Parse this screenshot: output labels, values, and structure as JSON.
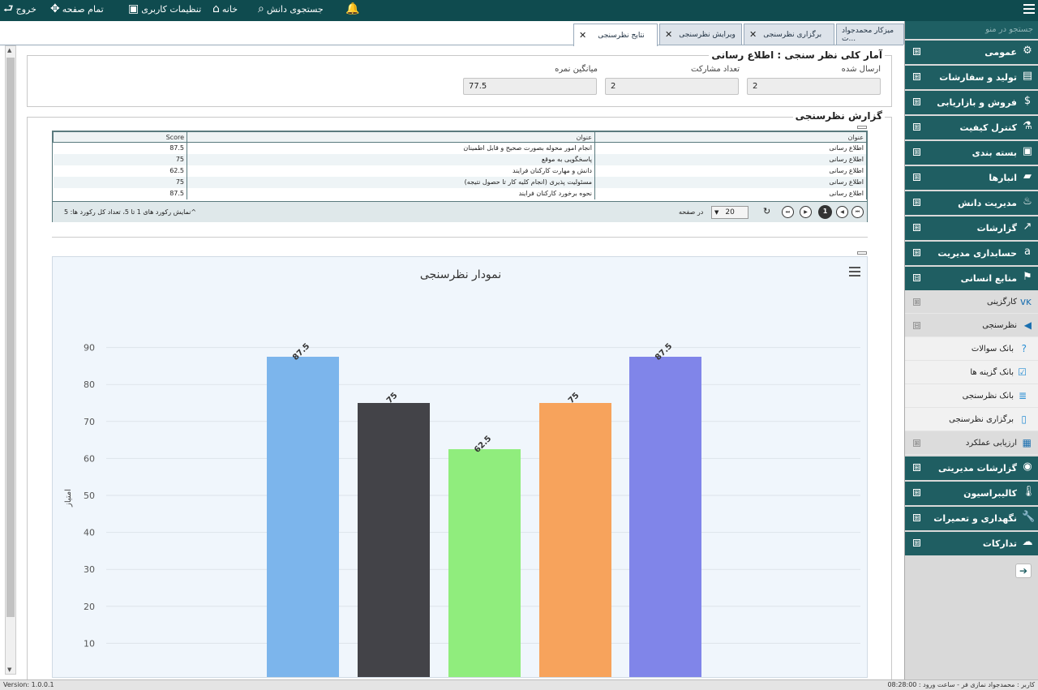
{
  "topbar": {
    "exit": "خروج",
    "fullscreen": "تمام صفحه",
    "user_settings": "تنظیمات کاربری",
    "home": "خانه",
    "knowledge_search": "جستجوی دانش"
  },
  "tabs": [
    {
      "label": "میزکار محمدجواد ت...",
      "closable": false
    },
    {
      "label": "برگزاری نظرسنجی",
      "closable": true
    },
    {
      "label": "ویرایش نظرسنجی",
      "closable": true
    },
    {
      "label": "نتایج نظرسنجی",
      "closable": true,
      "active": true
    }
  ],
  "stats": {
    "title": "آمار کلی نظر سنجی : اطلاع رسانی",
    "sent_label": "ارسال شده",
    "sent_value": "2",
    "participants_label": "تعداد مشارکت",
    "participants_value": "2",
    "avg_label": "میانگین نمره",
    "avg_value": "77.5"
  },
  "report": {
    "title": "گزارش نظرسنجی",
    "columns": [
      "عنوان",
      "عنوان",
      "Score"
    ],
    "rows": [
      [
        "اطلاع رسانی",
        "انجام امور محوله بصورت صحیح و قابل اطمینان",
        "87.5"
      ],
      [
        "اطلاع رسانی",
        "پاسخگویی به موقع",
        "75"
      ],
      [
        "اطلاع رسانی",
        "دانش و مهارت کارکنان فرایند",
        "62.5"
      ],
      [
        "اطلاع رسانی",
        "مسئولیت پذیری (انجام کلیه کار تا حصول نتیجه)",
        "75"
      ],
      [
        "اطلاع رسانی",
        "نحوه برخورد کارکنان فرایند",
        "87.5"
      ]
    ],
    "pager": {
      "current_page": "1",
      "page_size": "20",
      "per_page_label": "در صفحه",
      "summary": "^نمایش رکورد های 1 تا 5، تعداد کل رکورد ها: 5"
    }
  },
  "chart_data": {
    "type": "bar",
    "title": "نمودار نظرسنجی",
    "ylabel": "امتیاز",
    "xlabel": "",
    "ylim": [
      0,
      100
    ],
    "yticks": [
      0,
      10,
      20,
      30,
      40,
      50,
      60,
      70,
      80,
      90
    ],
    "grid": true,
    "values": [
      87.5,
      75,
      62.5,
      75,
      87.5
    ],
    "data_labels": [
      "87.5",
      "75",
      "62.5",
      "75",
      "87.5"
    ],
    "colors": [
      "#7cb5ec",
      "#434348",
      "#90ed7d",
      "#f7a35c",
      "#8085e9"
    ]
  },
  "sidebar": {
    "search_placeholder": "جستجو در منو",
    "items": [
      {
        "label": "عمومی",
        "icon": "gears-icon",
        "glyph": "⚙",
        "toggle": "⊞"
      },
      {
        "label": "تولید و سفارشات",
        "icon": "database-icon",
        "glyph": "▤",
        "toggle": "⊞"
      },
      {
        "label": "فروش و بازاریابی",
        "icon": "dollar-icon",
        "glyph": "$",
        "toggle": "⊞"
      },
      {
        "label": "کنترل کیفیت",
        "icon": "flask-icon",
        "glyph": "⚗",
        "toggle": "⊞"
      },
      {
        "label": "بسته بندی",
        "icon": "package-icon",
        "glyph": "▣",
        "toggle": "⊞"
      },
      {
        "label": "انبارها",
        "icon": "truck-icon",
        "glyph": "▰",
        "toggle": "⊞"
      },
      {
        "label": "مدیریت دانش",
        "icon": "knowledge-icon",
        "glyph": "♨",
        "toggle": "⊞"
      },
      {
        "label": "گزارشات",
        "icon": "line-chart-icon",
        "glyph": "↗",
        "toggle": "⊞"
      },
      {
        "label": "حسابداری مدیریت",
        "icon": "amazon-icon",
        "glyph": "a",
        "toggle": "⊞"
      },
      {
        "label": "منابع انسانی",
        "icon": "flag-icon",
        "glyph": "⚑",
        "toggle": "⊟"
      }
    ],
    "hr_sub": [
      {
        "label": "کارگزینی",
        "icon": "vk-icon",
        "glyph": "ᴠᴋ",
        "toggle": "⊞"
      },
      {
        "label": "نظرسنجی",
        "icon": "megaphone-icon",
        "glyph": "◀",
        "toggle": "⊟"
      }
    ],
    "survey_leaves": [
      {
        "label": "بانک سوالات",
        "icon": "question-icon",
        "glyph": "?"
      },
      {
        "label": "بانک گزینه ها",
        "icon": "checkbox-icon",
        "glyph": "☑"
      },
      {
        "label": "بانک نظرسنجی",
        "icon": "database-icon",
        "glyph": "≣"
      },
      {
        "label": "برگزاری نظرسنجی",
        "icon": "bookmark-icon",
        "glyph": "▯"
      }
    ],
    "hr_sub2": [
      {
        "label": "ارزیابی عملکرد",
        "icon": "calendar-icon",
        "glyph": "▦",
        "toggle": "⊞"
      }
    ],
    "items2": [
      {
        "label": "گزارشات مدیریتی",
        "icon": "dashboard-icon",
        "glyph": "◉",
        "toggle": "⊞"
      },
      {
        "label": "کالیبراسیون",
        "icon": "thermometer-icon",
        "glyph": "🌡",
        "toggle": "⊞"
      },
      {
        "label": "نگهداری و تعمیرات",
        "icon": "wrench-icon",
        "glyph": "🔧",
        "toggle": "⊞"
      },
      {
        "label": "تدارکات",
        "icon": "cloud-icon",
        "glyph": "☁",
        "toggle": "⊞"
      }
    ]
  },
  "status": {
    "version": "Version: 1.0.0.1",
    "user_info": "کاربر : محمدجواد نمازی فر - ساعت ورود : 08:28:00"
  }
}
